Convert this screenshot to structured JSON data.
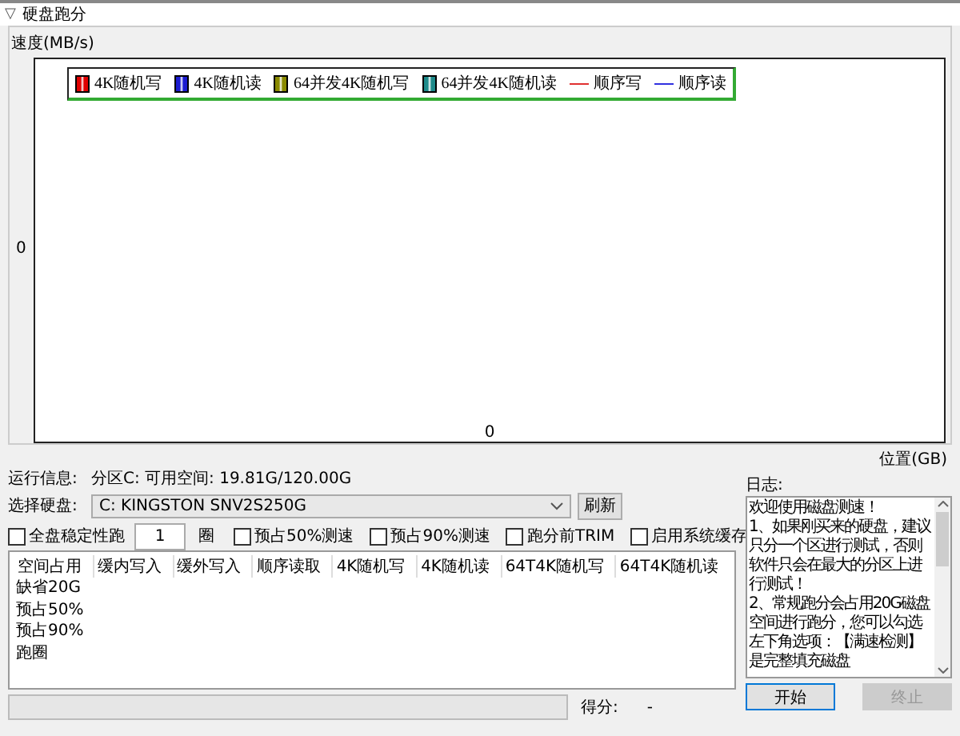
{
  "window": {
    "title": "硬盘跑分",
    "collapse_icon": "▽"
  },
  "chart": {
    "ylabel": "速度(MB/s)",
    "y_zero": "0",
    "x_zero": "0",
    "xlabel": "位置(GB)",
    "legend": [
      {
        "kind": "swatch",
        "label": "4K随机写",
        "color": "#e00000"
      },
      {
        "kind": "swatch",
        "label": "4K随机读",
        "color": "#1c1cd0"
      },
      {
        "kind": "swatch",
        "label": "64并发4K随机写",
        "color": "#8a8a00"
      },
      {
        "kind": "swatch",
        "label": "64并发4K随机读",
        "color": "#1e8a8a"
      },
      {
        "kind": "line",
        "label": "顺序写",
        "color": "#e03030"
      },
      {
        "kind": "line",
        "label": "顺序读",
        "color": "#3030e0"
      }
    ]
  },
  "info": {
    "label": "运行信息:",
    "value": "分区C: 可用空间: 19.81G/120.00G"
  },
  "disk": {
    "label": "选择硬盘:",
    "value": "C: KINGSTON SNV2S250G",
    "refresh": "刷新"
  },
  "options": [
    {
      "kind": "checkbox",
      "label": "全盘稳定性跑",
      "checked": false
    },
    {
      "kind": "number",
      "value": "1",
      "unit": "圈"
    },
    {
      "kind": "checkbox",
      "label": "预占50%测速",
      "checked": false
    },
    {
      "kind": "checkbox",
      "label": "预占90%测速",
      "checked": false
    },
    {
      "kind": "checkbox",
      "label": "跑分前TRIM",
      "checked": false
    },
    {
      "kind": "checkbox",
      "label": "启用系统缓存",
      "checked": false
    }
  ],
  "table": {
    "columns": [
      "空间占用",
      "缓内写入",
      "缓外写入",
      "顺序读取",
      "4K随机写",
      "4K随机读",
      "64T4K随机写",
      "64T4K随机读"
    ],
    "rows": [
      [
        "缺省20G"
      ],
      [
        "预占50%"
      ],
      [
        "预占90%"
      ],
      [
        "跑圈"
      ]
    ]
  },
  "log": {
    "label": "日志:",
    "text": "欢迎使用磁盘测速！\n1、如果刚买来的硬盘，建议只分一个区进行测试，否则软件只会在最大的分区上进行测试！\n2、常规跑分会占用20G磁盘空间进行跑分，您可以勾选左下角选项：【满速检测】是完整填充磁盘"
  },
  "progress": {
    "level": 0
  },
  "score": {
    "label": "得分:",
    "value": "-"
  },
  "buttons": [
    {
      "label": "开始",
      "disabled": false
    },
    {
      "label": "终止",
      "disabled": true
    }
  ]
}
